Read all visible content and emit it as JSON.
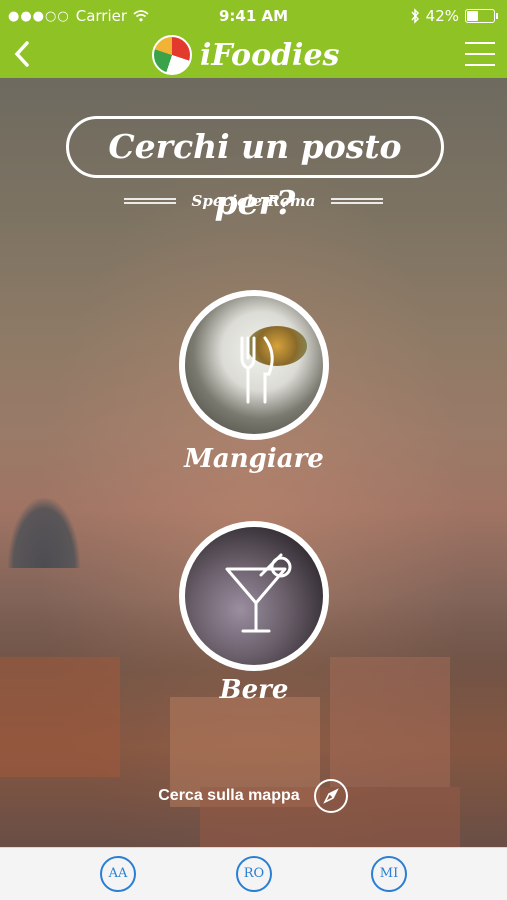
{
  "status_bar": {
    "carrier": "Carrier",
    "time": "9:41 AM",
    "battery": "42%",
    "battery_level": 0.42
  },
  "nav": {
    "app_name": "iFoodies",
    "back_icon": "chevron-left-icon",
    "menu_icon": "hamburger-menu-icon"
  },
  "header": {
    "title": "Cerchi un posto per?",
    "subtitle": "Speciale Roma"
  },
  "choices": [
    {
      "label": "Mangiare",
      "icon": "fork-knife-icon"
    },
    {
      "label": "Bere",
      "icon": "cocktail-glass-icon"
    }
  ],
  "map_link": {
    "label": "Cerca sulla mappa",
    "icon": "compass-icon"
  },
  "tabs": [
    {
      "label": "AA"
    },
    {
      "label": "RO"
    },
    {
      "label": "MI"
    }
  ],
  "colors": {
    "accent": "#8fc224",
    "tab_blue": "#2a7fd4"
  }
}
